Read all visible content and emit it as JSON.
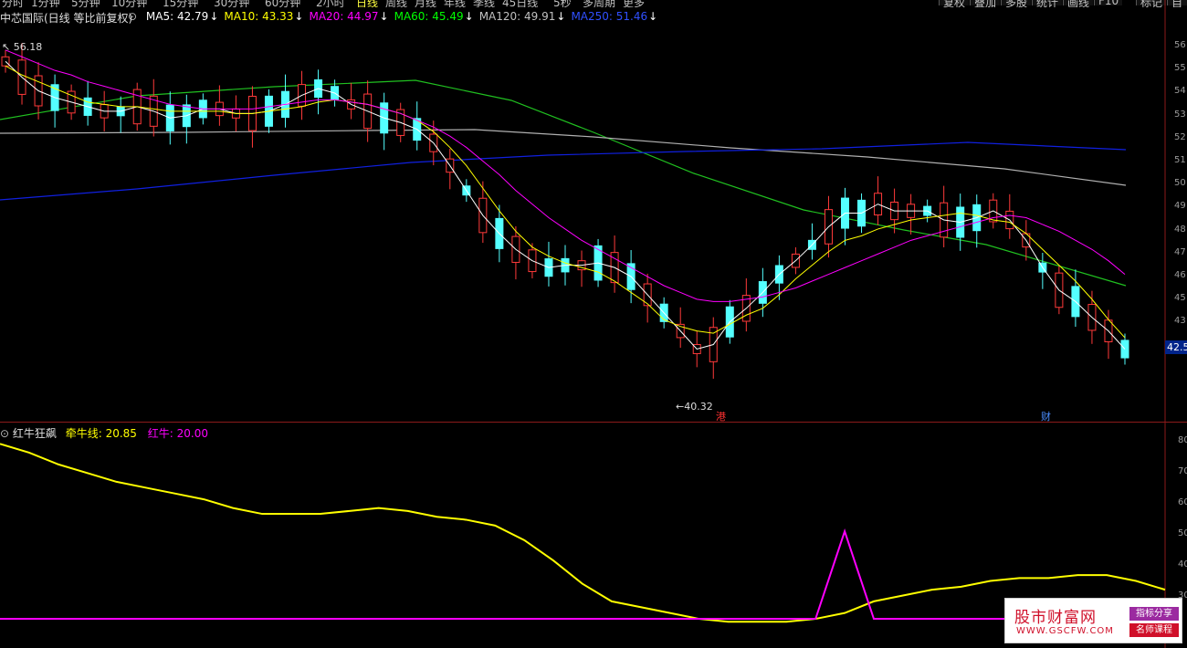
{
  "toolbar": {
    "periods": [
      "分时",
      "1分钟",
      "5分钟",
      "10分钟",
      "15分钟",
      "30分钟",
      "60分钟",
      "2小时",
      "日线",
      "周线",
      "月线",
      "年线",
      "季线",
      "45日线",
      "5秒",
      "多周期",
      "更多"
    ],
    "active_period": "日线",
    "right_buttons": [
      "复权",
      "叠加",
      "多股",
      "统计",
      "画线",
      "F10",
      "标记",
      "自选"
    ],
    "close_icon": "close-icon",
    "settings_icon": "gear-icon"
  },
  "main_chart": {
    "stock_title": "中芯国际(日线 等比前复权)",
    "ma": [
      {
        "label": "MA5: 42.79",
        "color": "#ffffff"
      },
      {
        "label": "MA10: 43.33",
        "color": "#ffff00"
      },
      {
        "label": "MA20: 44.97",
        "color": "#ff00ff"
      },
      {
        "label": "MA60: 45.49",
        "color": "#00ff00"
      },
      {
        "label": "MA120: 49.91",
        "color": "#c0c0c0"
      },
      {
        "label": "MA250: 51.46",
        "color": "#3050ff"
      }
    ],
    "high_label": "56.18",
    "low_label": "40.32",
    "current_price": "42.5",
    "event_markers": [
      {
        "text": "港",
        "color": "#ff3030"
      },
      {
        "text": "财",
        "color": "#4a8dff"
      }
    ],
    "y_ticks": [
      "56",
      "55",
      "54",
      "53",
      "52",
      "51",
      "50",
      "49",
      "48",
      "47",
      "46",
      "45",
      "43",
      "42"
    ]
  },
  "indicator": {
    "name": "红牛狂飙",
    "line1": {
      "label": "牵牛线: 20.85",
      "color": "#ffff00"
    },
    "line2": {
      "label": "红牛: 20.00",
      "color": "#ff00ff"
    },
    "y_ticks": [
      "80",
      "70",
      "60",
      "50",
      "40",
      "30"
    ]
  },
  "chart_data": [
    {
      "type": "candlestick",
      "title": "中芯国际(日线 等比前复权)",
      "series": [
        {
          "name": "MA5",
          "values": [
            55.5,
            54.8,
            54.2,
            53.9,
            53.7,
            53.5,
            53.3,
            53.3,
            53.5,
            53.3,
            53.0,
            53.1,
            53.4,
            53.4,
            53.2,
            53.2,
            53.3,
            53.6,
            54.0,
            54.3,
            54.1,
            53.6,
            53.3,
            53.0,
            52.8,
            52.5,
            51.9,
            50.9,
            49.8,
            48.7,
            47.9,
            47.2,
            46.7,
            46.4,
            46.5,
            46.5,
            46.6,
            46.4,
            46.0,
            45.2,
            44.4,
            43.6,
            42.8,
            43.0,
            44.0,
            44.6,
            45.3,
            46.1,
            46.7,
            47.4,
            48.2,
            48.8,
            48.8,
            49.2,
            48.9,
            48.9,
            48.9,
            48.5,
            48.4,
            48.6,
            48.9,
            48.5,
            47.6,
            46.4,
            45.4,
            44.9,
            44.2,
            43.6,
            42.8
          ]
        },
        {
          "name": "MA10",
          "values": [
            55.3,
            54.9,
            54.6,
            54.3,
            54.0,
            53.7,
            53.6,
            53.5,
            53.5,
            53.4,
            53.3,
            53.3,
            53.3,
            53.3,
            53.2,
            53.2,
            53.3,
            53.4,
            53.5,
            53.7,
            53.8,
            53.7,
            53.6,
            53.4,
            53.2,
            52.9,
            52.4,
            51.7,
            50.9,
            49.9,
            48.9,
            48.0,
            47.3,
            46.9,
            46.6,
            46.4,
            46.2,
            45.8,
            45.3,
            44.8,
            44.1,
            43.8,
            43.6,
            43.5,
            43.9,
            44.3,
            44.6,
            45.2,
            45.9,
            46.5,
            47.1,
            47.6,
            47.8,
            48.1,
            48.3,
            48.5,
            48.6,
            48.7,
            48.8,
            48.7,
            48.5,
            48.4,
            47.9,
            47.2,
            46.5,
            45.8,
            45.0,
            44.1,
            43.3
          ]
        },
        {
          "name": "MA20",
          "values": [
            56.0,
            55.7,
            55.4,
            55.1,
            54.9,
            54.6,
            54.4,
            54.2,
            54.0,
            53.8,
            53.6,
            53.5,
            53.4,
            53.4,
            53.4,
            53.4,
            53.5,
            53.6,
            53.7,
            53.8,
            53.8,
            53.7,
            53.6,
            53.4,
            53.2,
            52.9,
            52.6,
            52.2,
            51.7,
            51.1,
            50.5,
            49.8,
            49.2,
            48.6,
            48.1,
            47.6,
            47.2,
            46.8,
            46.4,
            46.0,
            45.6,
            45.3,
            45.0,
            44.9,
            44.9,
            45.0,
            45.1,
            45.3,
            45.5,
            45.8,
            46.1,
            46.4,
            46.7,
            47.0,
            47.3,
            47.6,
            47.8,
            48.0,
            48.2,
            48.4,
            48.6,
            48.7,
            48.6,
            48.3,
            48.0,
            47.6,
            47.2,
            46.7,
            46.1
          ]
        }
      ],
      "y_range": [
        40,
        57
      ]
    },
    {
      "type": "line",
      "title": "红牛狂飙",
      "series": [
        {
          "name": "牵牛线",
          "values": [
            80,
            77,
            73,
            70,
            67,
            65,
            63,
            61,
            58,
            56,
            56,
            56,
            57,
            58,
            57,
            55,
            54,
            52,
            47,
            40,
            32,
            26,
            24,
            22,
            20,
            19,
            19,
            19,
            20,
            22,
            26,
            28,
            30,
            31,
            33,
            34,
            34,
            35,
            35,
            33,
            30
          ]
        },
        {
          "name": "红牛",
          "values": [
            20,
            20,
            20,
            20,
            20,
            20,
            20,
            20,
            20,
            20,
            20,
            20,
            20,
            20,
            20,
            20,
            20,
            20,
            20,
            20,
            20,
            20,
            20,
            20,
            20,
            20,
            20,
            20,
            20,
            50,
            20,
            20,
            20,
            20,
            20,
            20,
            20,
            20,
            20,
            20,
            20
          ]
        }
      ],
      "y_range": [
        10,
        82
      ]
    }
  ],
  "watermark": {
    "title": "股市财富网",
    "url": "WWW.GSCFW.COM",
    "tag1": "指标分享",
    "tag2": "名师课程"
  }
}
